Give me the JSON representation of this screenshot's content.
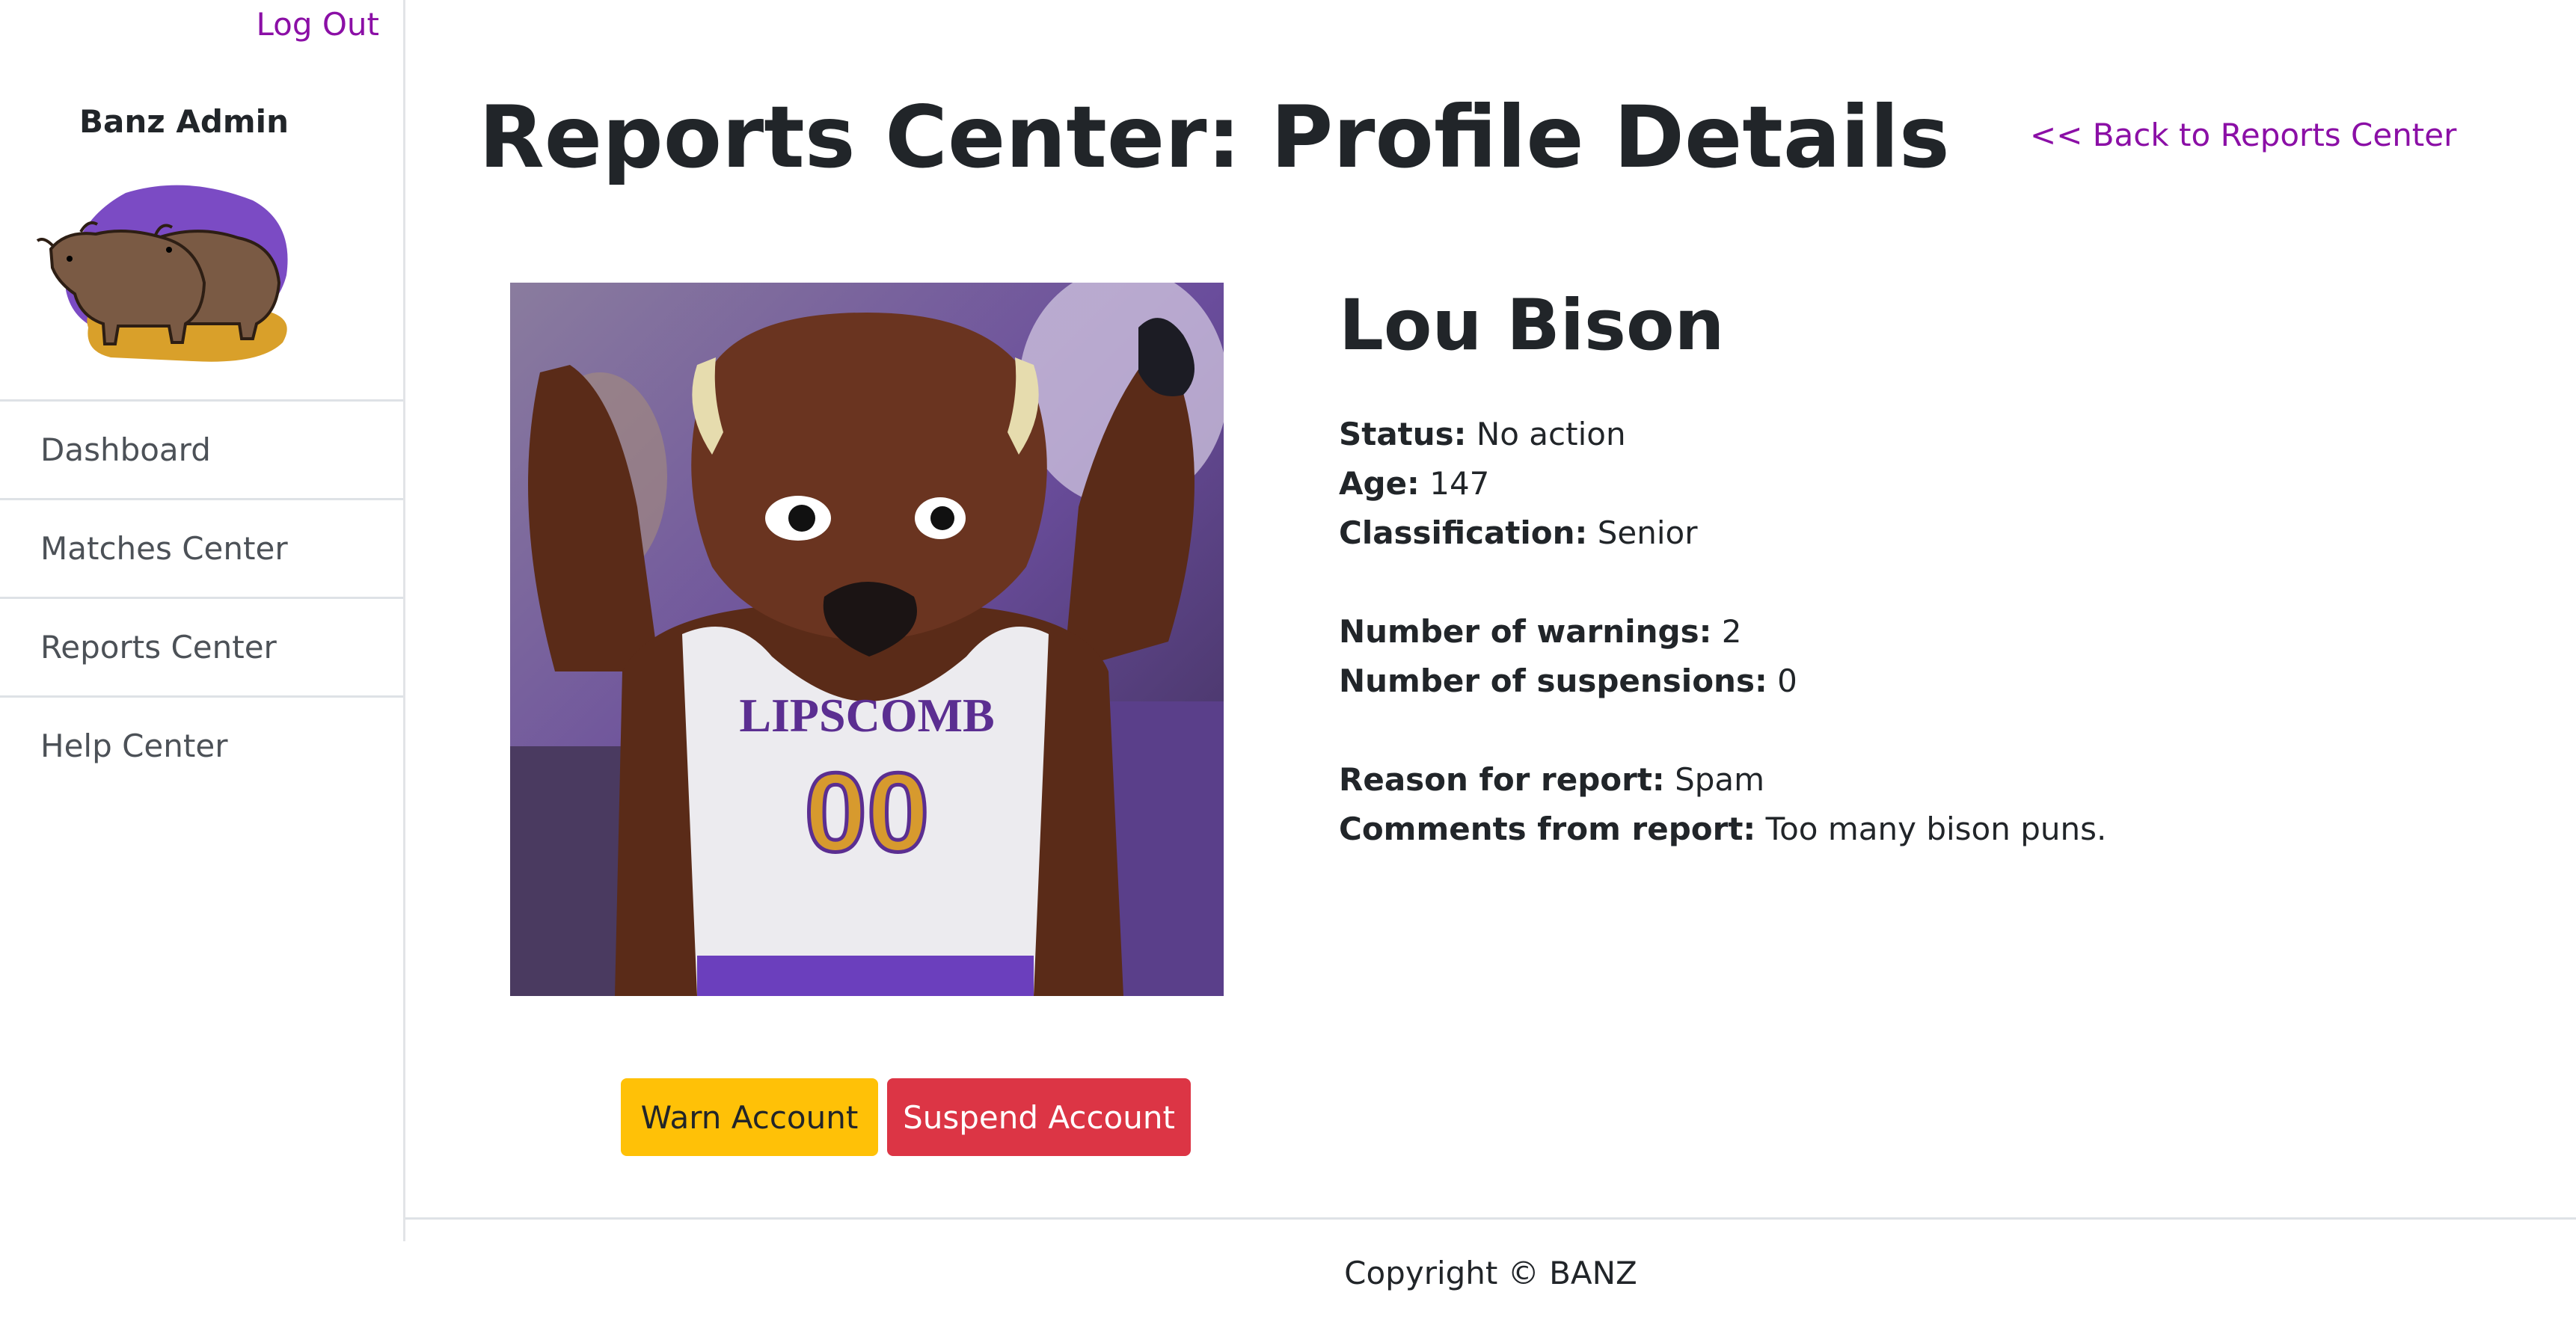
{
  "sidebar": {
    "logout_label": "Log Out",
    "brand": "Banz Admin",
    "nav": [
      {
        "label": "Dashboard"
      },
      {
        "label": "Matches Center"
      },
      {
        "label": "Reports Center"
      },
      {
        "label": "Help Center"
      }
    ]
  },
  "header": {
    "title": "Reports Center: Profile Details",
    "back_link": "<< Back to Reports Center"
  },
  "profile": {
    "name": "Lou Bison",
    "jersey_text": "LIPSCOMB",
    "jersey_number": "00",
    "status_label": "Status:",
    "status_value": "No action",
    "age_label": "Age:",
    "age_value": "147",
    "classification_label": "Classification:",
    "classification_value": "Senior",
    "warnings_label": "Number of warnings:",
    "warnings_value": "2",
    "suspensions_label": "Number of suspensions:",
    "suspensions_value": "0",
    "reason_label": "Reason for report:",
    "reason_value": "Spam",
    "comments_label": "Comments from report:",
    "comments_value": "Too many bison puns."
  },
  "actions": {
    "warn_label": "Warn Account",
    "suspend_label": "Suspend Account"
  },
  "footer": {
    "copyright": "Copyright © BANZ"
  },
  "colors": {
    "accent": "#8b0fa6",
    "warn": "#ffc107",
    "danger": "#dc3545"
  }
}
